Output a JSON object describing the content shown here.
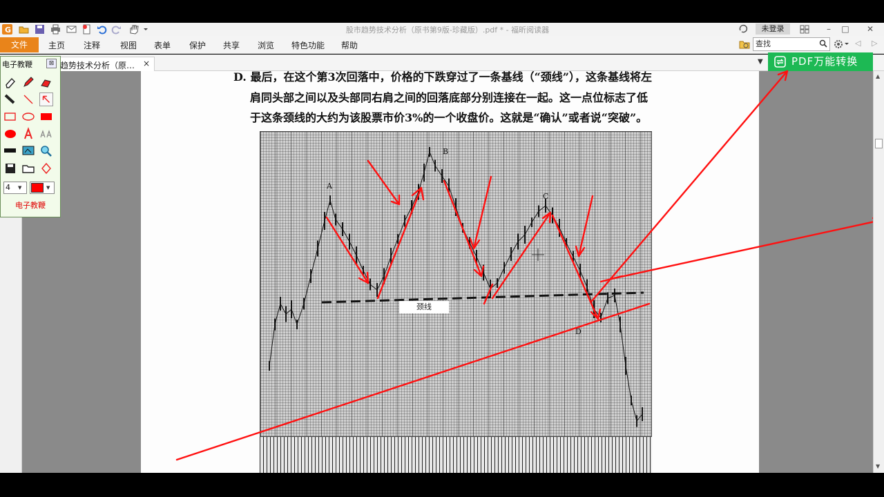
{
  "window": {
    "title": "股市趋势技术分析（原书第9版-珍藏版）.pdf * - 福昕阅读器",
    "login_label": "未登录",
    "controls": [
      "restore-icon",
      "minimize-icon",
      "maximize-icon",
      "close-icon"
    ]
  },
  "quick_access": {
    "icons": [
      "app-logo-icon",
      "open-folder-icon",
      "save-icon",
      "print-icon",
      "email-icon",
      "new-doc-icon",
      "undo-icon",
      "redo-icon",
      "hand-tool-icon"
    ]
  },
  "menu": {
    "file": "文件",
    "items": [
      "主页",
      "注释",
      "视图",
      "表单",
      "保护",
      "共享",
      "浏览",
      "特色功能",
      "帮助"
    ]
  },
  "search": {
    "placeholder": "查找"
  },
  "tabs": {
    "active_label": "趋势技术分析（原…",
    "close_glyph": "×"
  },
  "promo": {
    "label": "PDF万能转换"
  },
  "document": {
    "lines": [
      "D. 最后，在这个第3次回落中，价格的下跌穿过了一条基线（“颈线”），这条基线将左",
      "肩同头部之间以及头部同右肩之间的回落底部分别连接在一起。这一点位标志了低",
      "于这条颈线的大约为该股票市价3%的一个收盘价。这就是“确认”或者说“突破”。"
    ],
    "chart_labels": {
      "a": "A",
      "b": "B",
      "c": "C",
      "d": "D",
      "neckline": "颈线"
    }
  },
  "palette": {
    "title": "电子教鞭",
    "close_glyph": "⊠",
    "footer": "电子教鞭",
    "stroke_width": "4",
    "current_color": "#ff0000",
    "tools": [
      "eraser-icon",
      "pen-icon",
      "highlighter-icon",
      "marker-icon",
      "line-icon",
      "arrow-icon",
      "rectangle-icon",
      "ellipse-icon",
      "filled-rectangle-icon",
      "filled-ellipse-icon",
      "text-icon",
      "font-size-icon",
      "black-bar-icon",
      "screen-icon",
      "magnifier-icon",
      "save-icon",
      "open-icon",
      "clear-icon"
    ]
  },
  "colors": {
    "accent_orange": "#e9841a",
    "promo_green": "#1db954",
    "annotation_red": "#ff0000"
  }
}
